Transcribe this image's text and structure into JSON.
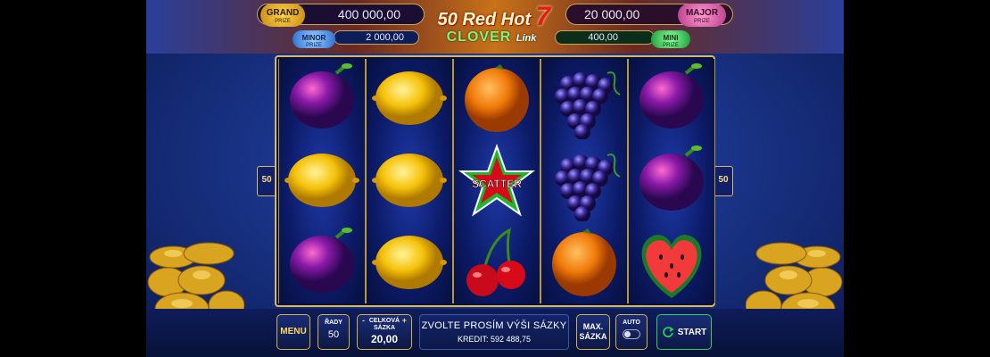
{
  "jackpots": {
    "grand": {
      "badge": "GRAND",
      "badge_sub": "PRIZE",
      "value": "400 000,00"
    },
    "major": {
      "badge": "MAJOR",
      "badge_sub": "PRIZE",
      "value": "20 000,00"
    },
    "minor": {
      "badge": "MINOR",
      "badge_sub": "PRIZE",
      "value": "2 000,00"
    },
    "mini": {
      "badge": "MINI",
      "badge_sub": "PRIZE",
      "value": "400,00"
    }
  },
  "logo": {
    "title": "50 Red Hot",
    "seven": "7",
    "subtitle": "CLOVER",
    "subtitle_tag": "Link"
  },
  "paylines": {
    "left": "50",
    "right": "50"
  },
  "reels": [
    [
      "plum",
      "lemon",
      "plum"
    ],
    [
      "lemon",
      "lemon",
      "lemon"
    ],
    [
      "orange",
      "scatter",
      "cherry"
    ],
    [
      "grapes",
      "grapes",
      "orange"
    ],
    [
      "plum",
      "plum",
      "watermelon"
    ]
  ],
  "scatter_text": "SCATTER",
  "controls": {
    "menu_label": "MENU",
    "lines_label": "ŘADY",
    "lines_value": "50",
    "bet_label": "CELKOVÁ SÁZKA",
    "bet_minus": "-",
    "bet_plus": "+",
    "bet_value": "20,00",
    "message": "ZVOLTE PROSÍM VÝŠI SÁZKY",
    "credit": "KREDIT: 592 488,75",
    "max_bet_label": "MAX. SÁZKA",
    "auto_label": "AUTO",
    "start_label": "START"
  },
  "colors": {
    "accent_gold": "#d0b24a",
    "start_green": "#2ad05a",
    "background_blue": "#1a358a"
  }
}
